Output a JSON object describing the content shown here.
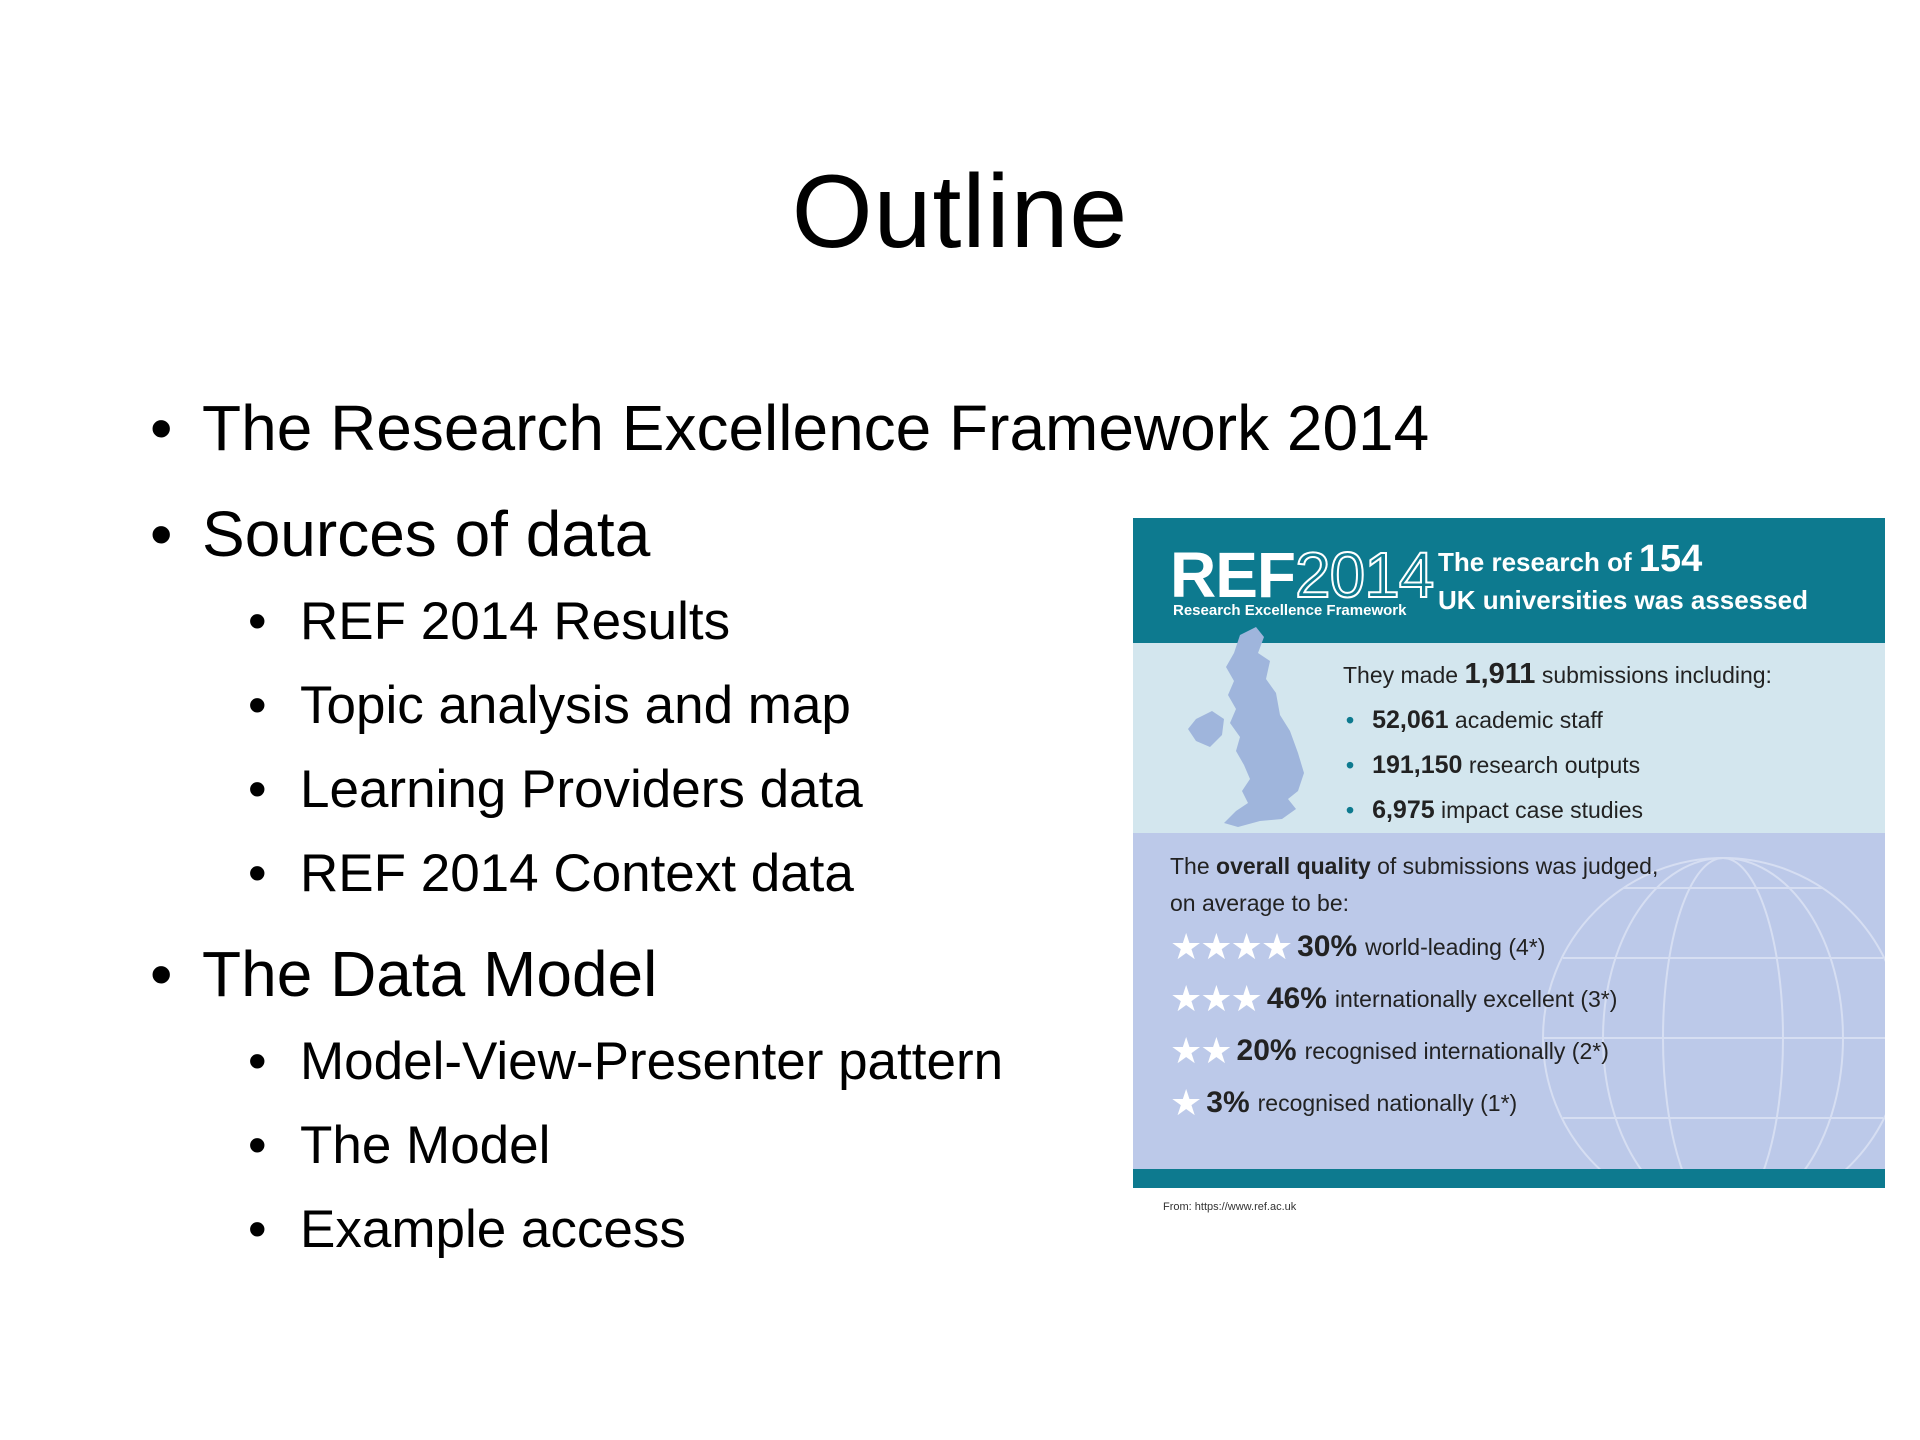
{
  "slide": {
    "title": "Outline",
    "items": [
      {
        "level": 1,
        "text": "The Research Excellence Framework 2014"
      },
      {
        "level": 1,
        "text": "Sources of data"
      },
      {
        "level": 2,
        "text": "REF 2014 Results"
      },
      {
        "level": 2,
        "text": "Topic analysis and map"
      },
      {
        "level": 2,
        "text": "Learning Providers data"
      },
      {
        "level": 2,
        "text": "REF 2014 Context data"
      },
      {
        "level": 1,
        "text": "The Data Model"
      },
      {
        "level": 2,
        "text": "Model-View-Presenter pattern"
      },
      {
        "level": 2,
        "text": "The Model"
      },
      {
        "level": 2,
        "text": "Example access"
      }
    ]
  },
  "infographic": {
    "logo": {
      "ref": "REF",
      "year": "2014",
      "subtitle": "Research Excellence Framework"
    },
    "headline": {
      "pre": "The research of ",
      "number": "154",
      "post": "UK universities was assessed"
    },
    "submissions": {
      "pre": "They made ",
      "number": "1,911",
      "post": " submissions including:"
    },
    "counts": [
      {
        "value": "52,061",
        "label": "academic staff"
      },
      {
        "value": "191,150",
        "label": "research outputs"
      },
      {
        "value": "6,975",
        "label": "impact case studies"
      }
    ],
    "quality": {
      "pre": "The ",
      "bold": "overall quality",
      "post": " of submissions was judged,",
      "line2": "on average to be:"
    },
    "ratings": [
      {
        "stars": "★★★★",
        "percent": "30%",
        "label": "world-leading (4*)"
      },
      {
        "stars": "★★★",
        "percent": "46%",
        "label": "internationally excellent (3*)"
      },
      {
        "stars": "★★",
        "percent": "20%",
        "label": "recognised internationally (2*)"
      },
      {
        "stars": "★",
        "percent": "3%",
        "label": "recognised nationally (1*)"
      }
    ],
    "colors": {
      "teal": "#0d7a8f",
      "light": "#d3e6ee",
      "blue": "#bcc9e9"
    }
  },
  "source_note": "From: https://www.ref.ac.uk"
}
